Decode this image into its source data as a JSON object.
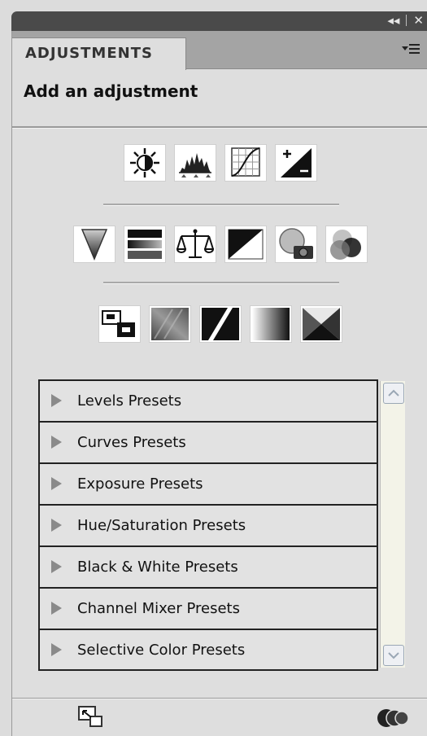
{
  "window": {
    "collapse_glyph": "◂◂",
    "close_glyph": "✕"
  },
  "tab": {
    "label": "ADJUSTMENTS"
  },
  "panel_menu_icon": "panel-menu-icon",
  "heading": "Add an adjustment",
  "adjustment_rows": [
    [
      "brightness-contrast-icon",
      "levels-icon",
      "curves-icon",
      "exposure-icon"
    ],
    [
      "vibrance-icon",
      "hue-saturation-icon",
      "color-balance-icon",
      "black-white-icon",
      "photo-filter-icon",
      "channel-mixer-icon"
    ],
    [
      "invert-icon",
      "posterize-icon",
      "threshold-icon",
      "gradient-map-icon",
      "selective-color-icon"
    ]
  ],
  "presets": [
    "Levels Presets",
    "Curves Presets",
    "Exposure Presets",
    "Hue/Saturation Presets",
    "Black & White Presets",
    "Channel Mixer Presets",
    "Selective Color Presets"
  ],
  "footer": {
    "left_icon": "expand-view-icon",
    "right_icon": "clip-layer-icon"
  }
}
